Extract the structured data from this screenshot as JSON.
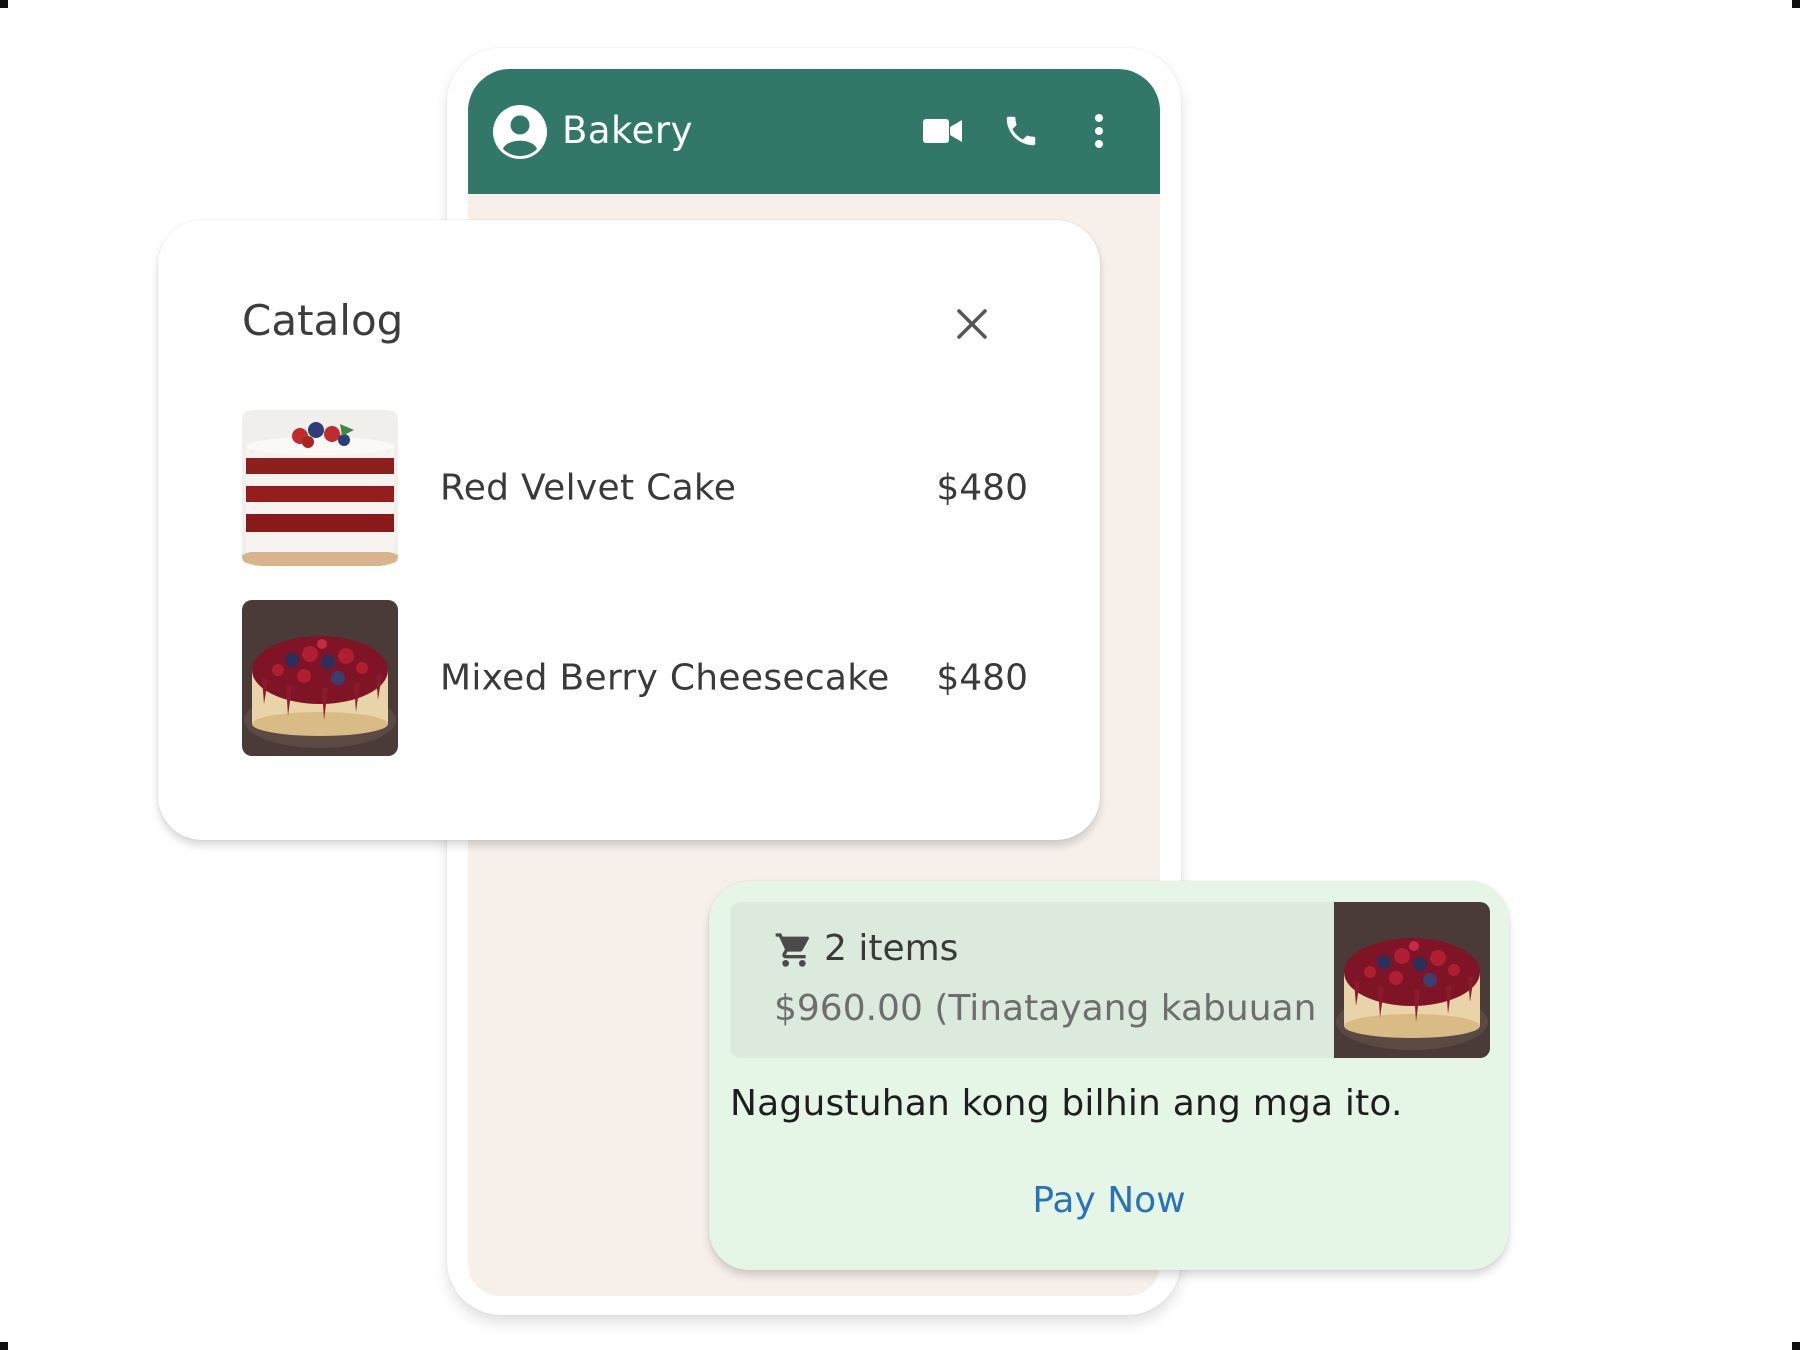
{
  "chat": {
    "title": "Bakery",
    "header_color": "#317868",
    "actions": [
      "video-call-icon",
      "phone-icon",
      "more-options-icon"
    ]
  },
  "catalog": {
    "title": "Catalog",
    "items": [
      {
        "name": "Red Velvet Cake",
        "price": "$480",
        "image": "red-velvet-cake-image"
      },
      {
        "name": "Mixed Berry Cheesecake",
        "price": "$480",
        "image": "mixed-berry-cheesecake-image"
      }
    ]
  },
  "order": {
    "items_count": "2 items",
    "total": "$960.00 (Tinatayang kabuuan",
    "message": "Nagustuhan kong bilhin ang mga ito.",
    "action_label": "Pay Now",
    "action_color": "#2a73b8",
    "bubble_color": "#e5f6e6"
  }
}
